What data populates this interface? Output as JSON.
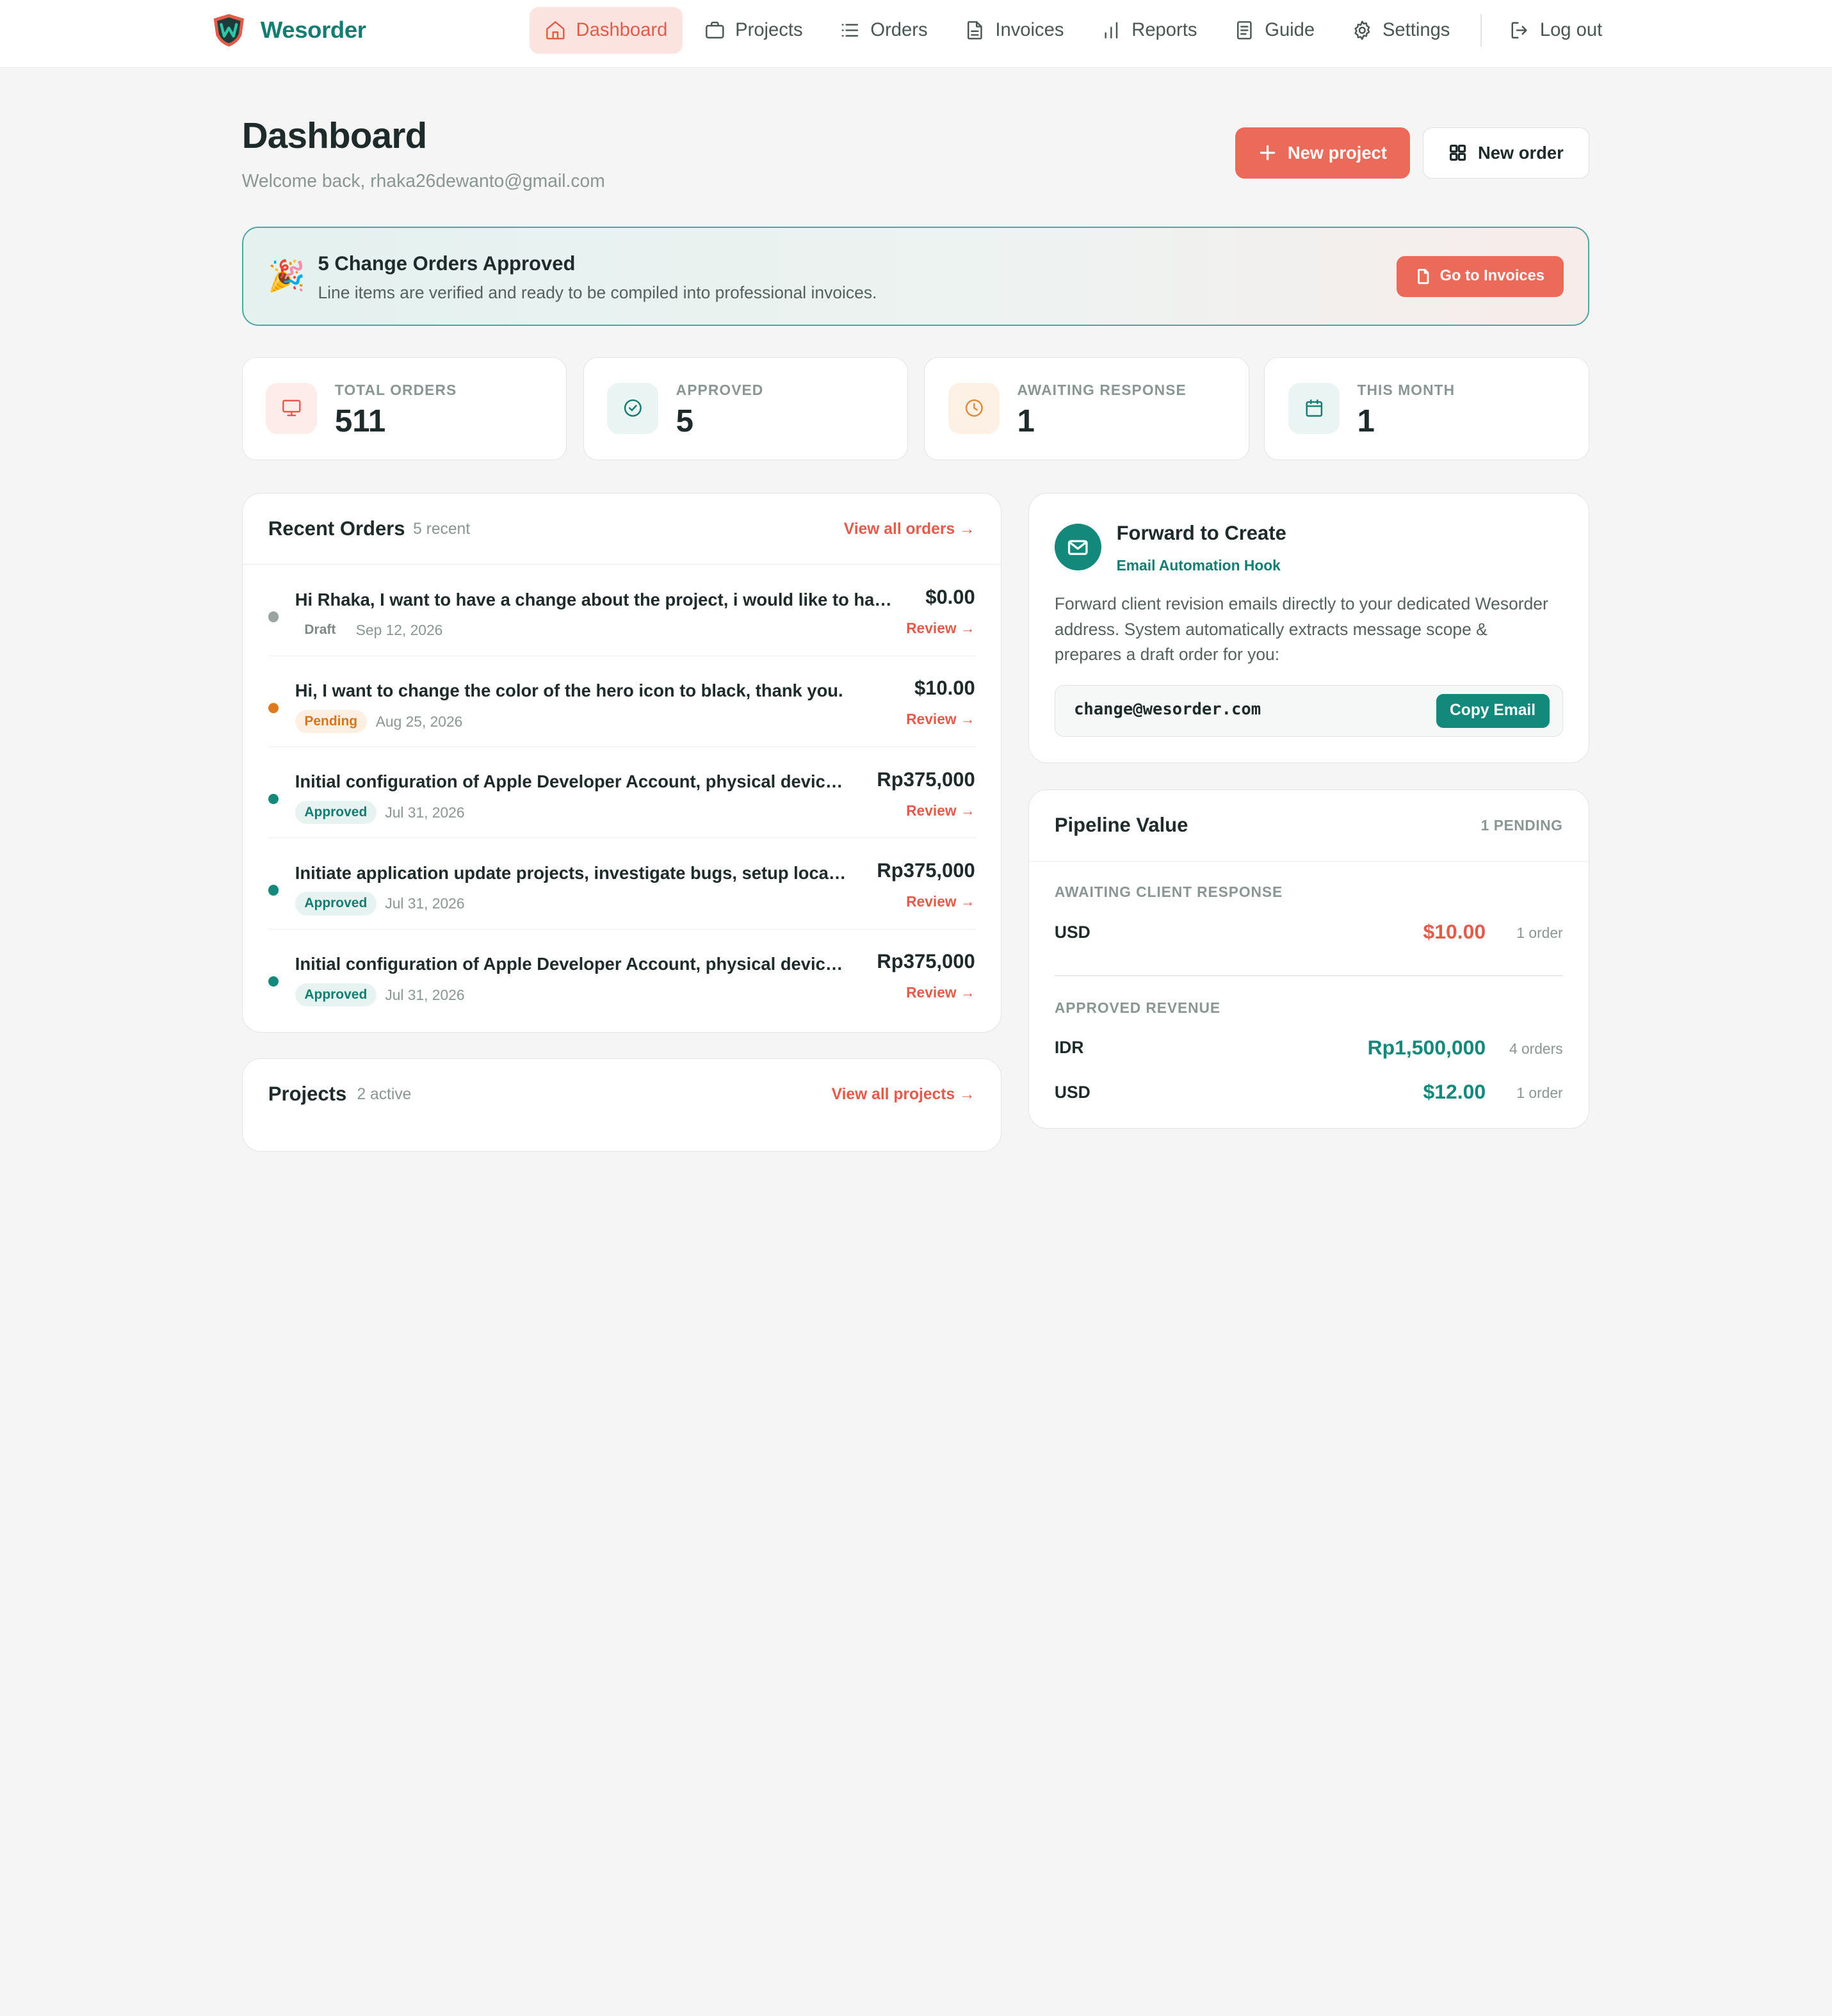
{
  "brand": {
    "name": "Wesorder",
    "logo_letter": "W"
  },
  "nav": {
    "items": [
      {
        "label": "Dashboard",
        "icon": "home-icon",
        "active": true
      },
      {
        "label": "Projects",
        "icon": "briefcase-icon",
        "active": false
      },
      {
        "label": "Orders",
        "icon": "list-icon",
        "active": false
      },
      {
        "label": "Invoices",
        "icon": "document-icon",
        "active": false
      },
      {
        "label": "Reports",
        "icon": "bar-chart-icon",
        "active": false
      },
      {
        "label": "Guide",
        "icon": "book-icon",
        "active": false
      },
      {
        "label": "Settings",
        "icon": "gear-icon",
        "active": false
      }
    ],
    "logout": {
      "label": "Log out",
      "icon": "logout-icon"
    }
  },
  "header": {
    "title": "Dashboard",
    "subtitle": "Welcome back, rhaka26dewanto@gmail.com",
    "new_project_label": "New project",
    "new_order_label": "New order"
  },
  "banner": {
    "emoji": "🎉",
    "title": "5 Change Orders Approved",
    "text": "Line items are verified and ready to be compiled into professional invoices.",
    "button_label": "Go to Invoices"
  },
  "stats": [
    {
      "label": "TOTAL ORDERS",
      "value": "511",
      "icon": "monitor-icon",
      "color": "#e25c4b",
      "bg": "#fdecea"
    },
    {
      "label": "APPROVED",
      "value": "5",
      "icon": "check-circle-icon",
      "color": "#137d72",
      "bg": "#eaf4f2"
    },
    {
      "label": "AWAITING RESPONSE",
      "value": "1",
      "icon": "clock-icon",
      "color": "#e08a3c",
      "bg": "#fdf1e6"
    },
    {
      "label": "THIS MONTH",
      "value": "1",
      "icon": "calendar-icon",
      "color": "#137d72",
      "bg": "#eaf4f2"
    }
  ],
  "recent_orders": {
    "title": "Recent Orders",
    "count": "5 recent",
    "link": "View all orders →",
    "items": [
      {
        "title": "Hi Rhaka, I want to have a change about the project, i would like to have i...",
        "status": "Draft",
        "date": "Sep 12, 2026",
        "amount": "$0.00",
        "review": "Review →"
      },
      {
        "title": "Hi, I want to change the color of the hero icon to black, thank you.",
        "status": "Pending",
        "date": "Aug 25, 2026",
        "amount": "$10.00",
        "review": "Review →"
      },
      {
        "title": "Initial configuration of Apple Developer Account, physical device U...",
        "status": "Approved",
        "date": "Jul 31, 2026",
        "amount": "Rp375,000",
        "review": "Review →"
      },
      {
        "title": "Initiate application update projects, investigate bugs, setup local co...",
        "status": "Approved",
        "date": "Jul 31, 2026",
        "amount": "Rp375,000",
        "review": "Review →"
      },
      {
        "title": "Initial configuration of Apple Developer Account, physical device U...",
        "status": "Approved",
        "date": "Jul 31, 2026",
        "amount": "Rp375,000",
        "review": "Review →"
      }
    ]
  },
  "status_colors": {
    "Draft": {
      "dot": "#9aa5a3",
      "bg": "transparent",
      "fg": "#7c8886"
    },
    "Pending": {
      "dot": "#e07a1f",
      "bg": "#fdf0e2",
      "fg": "#d9741b"
    },
    "Approved": {
      "dot": "#13897c",
      "bg": "#e6f3f1",
      "fg": "#137d72"
    }
  },
  "forward": {
    "title": "Forward to Create",
    "subtitle": "Email Automation Hook",
    "text": "Forward client revision emails directly to your dedicated Wesorder address. System automatically extracts message scope & prepares a draft order for you:",
    "email": "change@wesorder.com",
    "copy_label": "Copy Email"
  },
  "pipeline": {
    "title": "Pipeline Value",
    "pending": "1 PENDING",
    "awaiting_label": "AWAITING CLIENT RESPONSE",
    "awaiting": [
      {
        "currency": "USD",
        "amount": "$10.00",
        "count": "1 order"
      }
    ],
    "approved_label": "APPROVED REVENUE",
    "approved": [
      {
        "currency": "IDR",
        "amount": "Rp1,500,000",
        "count": "4 orders"
      },
      {
        "currency": "USD",
        "amount": "$12.00",
        "count": "1 order"
      }
    ]
  },
  "projects": {
    "title": "Projects",
    "count": "2 active",
    "link": "View all projects →"
  }
}
